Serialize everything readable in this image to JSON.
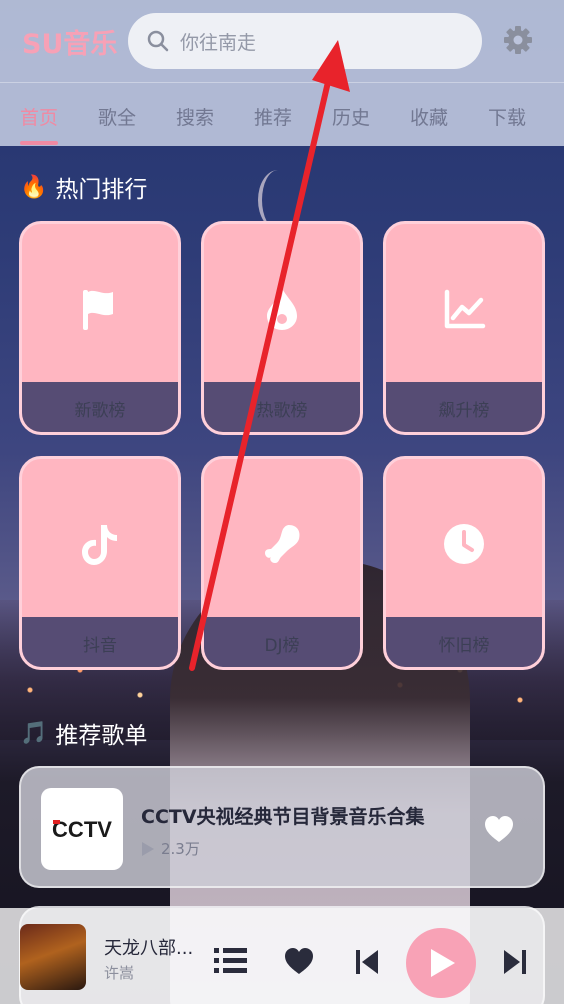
{
  "app": {
    "logo": "SU音乐"
  },
  "search": {
    "placeholder": "你往南走"
  },
  "tabs": [
    "首页",
    "歌全",
    "搜索",
    "推荐",
    "历史",
    "收藏",
    "下载"
  ],
  "hot": {
    "title": "热门排行",
    "title_icon": "fire-emoji",
    "cards": [
      {
        "label": "新歌榜",
        "icon": "flag-icon"
      },
      {
        "label": "热歌榜",
        "icon": "flame-icon"
      },
      {
        "label": "飙升榜",
        "icon": "trend-chart-icon"
      },
      {
        "label": "抖音",
        "icon": "tiktok-icon"
      },
      {
        "label": "DJ榜",
        "icon": "dj-icon"
      },
      {
        "label": "怀旧榜",
        "icon": "clock-icon"
      }
    ]
  },
  "recommend": {
    "title": "推荐歌单",
    "title_icon": "music-note-emoji",
    "playlists": [
      {
        "title": "CCTV央视经典节目背景音乐合集",
        "plays": "2.3万",
        "cover": "CCTV"
      }
    ]
  },
  "player": {
    "song": "天龙八部...",
    "artist": "许嵩"
  },
  "colors": {
    "accent": "#f08aa3",
    "card": "#ffb6c1",
    "header": "#bcc4dc"
  }
}
